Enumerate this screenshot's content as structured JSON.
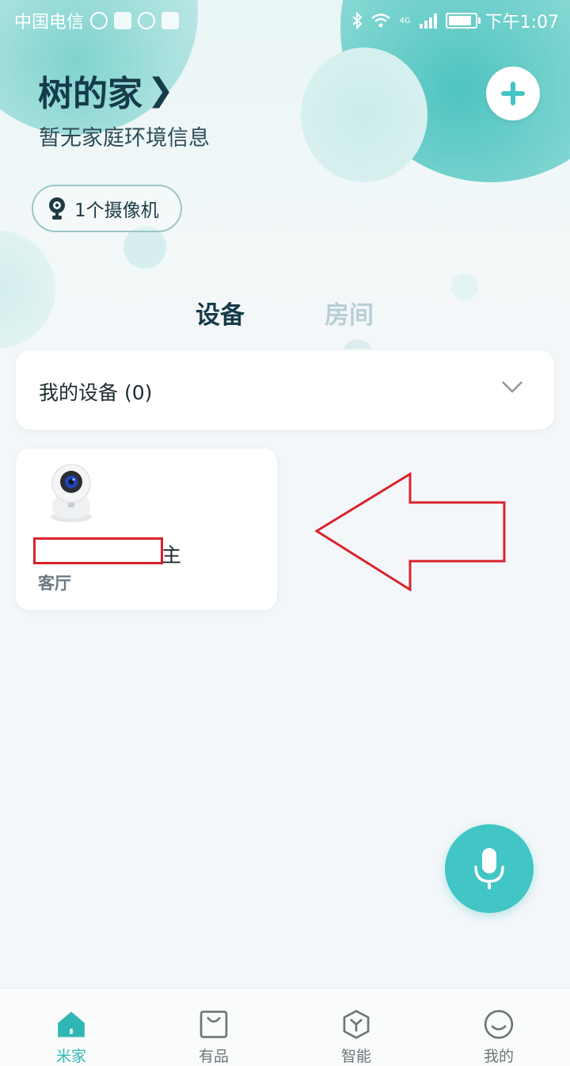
{
  "status_bar": {
    "carrier": "中国电信",
    "time": "下午1:07",
    "network": "4G"
  },
  "header": {
    "home_name": "树的家",
    "chevron": "❯",
    "subtitle": "暂无家庭环境信息",
    "add_icon": "plus-icon"
  },
  "camera_pill": {
    "label": "1个摄像机",
    "icon": "camera-icon"
  },
  "tabs": [
    {
      "label": "设备",
      "active": true
    },
    {
      "label": "房间",
      "active": false
    }
  ],
  "my_devices": {
    "label": "我的设备 (0)"
  },
  "device_card": {
    "name_visible": "主",
    "room": "客厅",
    "icon": "security-camera-icon"
  },
  "colors": {
    "accent": "#41c5c5",
    "title": "#163b4a",
    "annotation_red": "#d9232c"
  },
  "bottom_nav": [
    {
      "label": "米家",
      "icon": "home-icon",
      "active": true
    },
    {
      "label": "有品",
      "icon": "shopping-bag-icon",
      "active": false
    },
    {
      "label": "智能",
      "icon": "cube-icon",
      "active": false
    },
    {
      "label": "我的",
      "icon": "smiley-icon",
      "active": false
    }
  ]
}
